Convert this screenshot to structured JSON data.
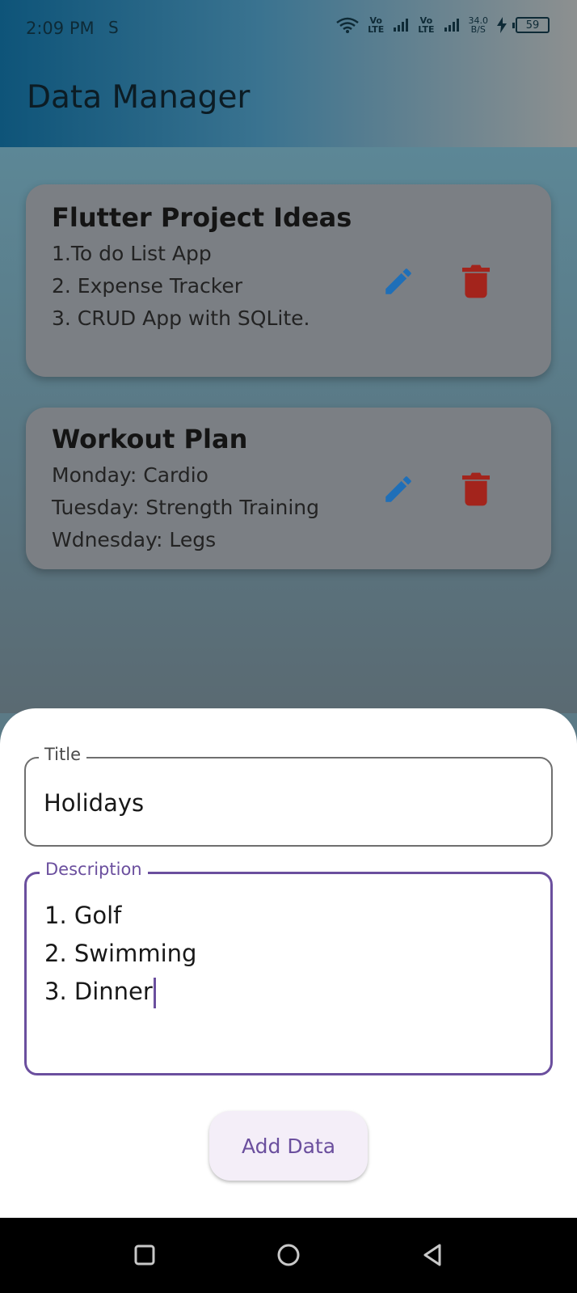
{
  "status_bar": {
    "time": "2:09 PM",
    "s_icon": "S",
    "lte_1": "Vo\nLTE",
    "lte_2": "Vo\nLTE",
    "speed": "34.0\nB/S",
    "battery": "59",
    "icons": [
      "wifi-icon",
      "signal-icon",
      "charging-icon",
      "battery-icon"
    ]
  },
  "app_bar": {
    "title": "Data Manager"
  },
  "items": [
    {
      "title": "Flutter Project Ideas",
      "description": "1.To do List App\n2. Expense Tracker\n3. CRUD App with SQLite."
    },
    {
      "title": "Workout Plan",
      "description": "Monday: Cardio\nTuesday: Strength Training\nWdnesday: Legs"
    }
  ],
  "form": {
    "title_label": "Title",
    "title_value": "Holidays",
    "description_label": "Description",
    "description_value": "1. Golf\n2. Swimming\n3. Dinner",
    "submit_label": "Add Data"
  },
  "colors": {
    "accent": "#6b4f9e",
    "edit": "#1f6fb8",
    "delete": "#a3241c"
  },
  "nav_icons": [
    "recent-apps-icon",
    "home-icon",
    "back-icon"
  ]
}
